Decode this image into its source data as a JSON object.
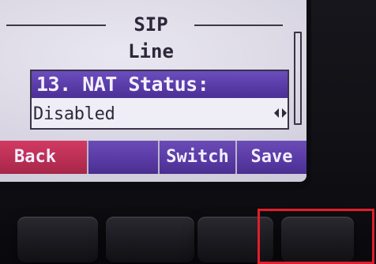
{
  "screen": {
    "title": "SIP Line",
    "item": {
      "label": "13. NAT Status:",
      "value": "Disabled",
      "value_control_icon": "left-right-arrows-icon"
    },
    "softkeys": {
      "back": "Back",
      "blank": "",
      "switch": "Switch",
      "save": "Save"
    }
  },
  "colors": {
    "selection_purple": "#5a3ca8",
    "back_red": "#bb2f55",
    "highlight_red": "#e31d2a"
  }
}
